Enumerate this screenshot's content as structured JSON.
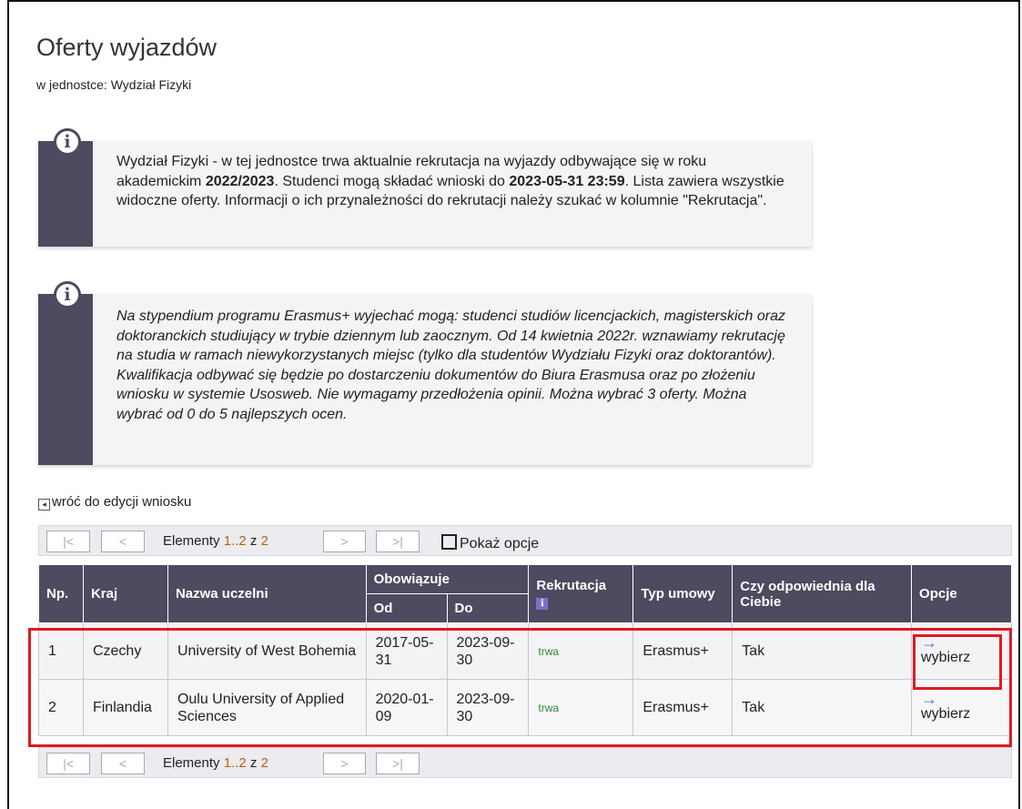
{
  "page": {
    "title": "Oferty wyjazdów",
    "subtitle": "w jednostce: Wydział Fizyki"
  },
  "info_boxes": [
    {
      "icon": "info-icon",
      "text_parts": [
        "Wydział Fizyki - w tej jednostce trwa aktualnie rekrutacja na wyjazdy odbywające się w roku akademickim ",
        "2022/2023",
        ". Studenci mogą składać wnioski do ",
        "2023-05-31 23:59",
        ". Lista zawiera wszystkie widoczne oferty. Informacji o ich przynależności do rekrutacji należy szukać w kolumnie \"Rekrutacja\"."
      ]
    },
    {
      "icon": "info-icon",
      "text": "Na stypendium programu Erasmus+ wyjechać mogą: studenci studiów licencjackich, magisterskich oraz doktoranckich studiujący w trybie dziennym lub zaocznym. Od 14 kwietnia 2022r. wznawiamy rekrutację na studia w ramach niewykorzystanych miejsc (tylko dla studentów Wydziału Fizyki oraz doktorantów). Kwalifikacja odbywać się będzie po dostarczeniu dokumentów do Biura Erasmusa oraz po złożeniu wniosku w systemie Usosweb. Nie wymagamy przedłożenia opinii. Można wybrać 3 oferty. Można wybrać od 0 do 5 najlepszych ocen."
    }
  ],
  "back_link": {
    "icon": "back-arrow-icon",
    "label": "wróć do edycji wniosku"
  },
  "pager": {
    "first": "|<",
    "prev": "<",
    "next": ">",
    "last": ">|",
    "elements_label": "Elementy",
    "range": "1..2",
    "of_label": "z",
    "total": "2",
    "show_options": "Pokaż opcje"
  },
  "table": {
    "headers": {
      "np": "Np.",
      "country": "Kraj",
      "university": "Nazwa uczelni",
      "valid": "Obowiązuje",
      "from": "Od",
      "to": "Do",
      "recruitment": "Rekrutacja",
      "recruitment_info": "i",
      "contract": "Typ umowy",
      "suitable": "Czy odpowiednia dla Ciebie",
      "options": "Opcje"
    },
    "rows": [
      {
        "np": "1",
        "country": "Czechy",
        "university": "University of West Bohemia",
        "from": "2017-05-31",
        "to": "2023-09-30",
        "recruitment": "trwa",
        "contract": "Erasmus+",
        "suitable": "Tak",
        "option_arrow": "→",
        "option": "wybierz"
      },
      {
        "np": "2",
        "country": "Finlandia",
        "university": "Oulu University of Applied Sciences",
        "from": "2020-01-09",
        "to": "2023-09-30",
        "recruitment": "trwa",
        "contract": "Erasmus+",
        "suitable": "Tak",
        "option_arrow": "→",
        "option": "wybierz"
      }
    ]
  },
  "colors": {
    "header_bg": "#4e4a5f",
    "highlight": "#e01a22",
    "status_green": "#2f8a2f",
    "link_blue": "#3c78c3",
    "pager_number": "#b5650f"
  }
}
